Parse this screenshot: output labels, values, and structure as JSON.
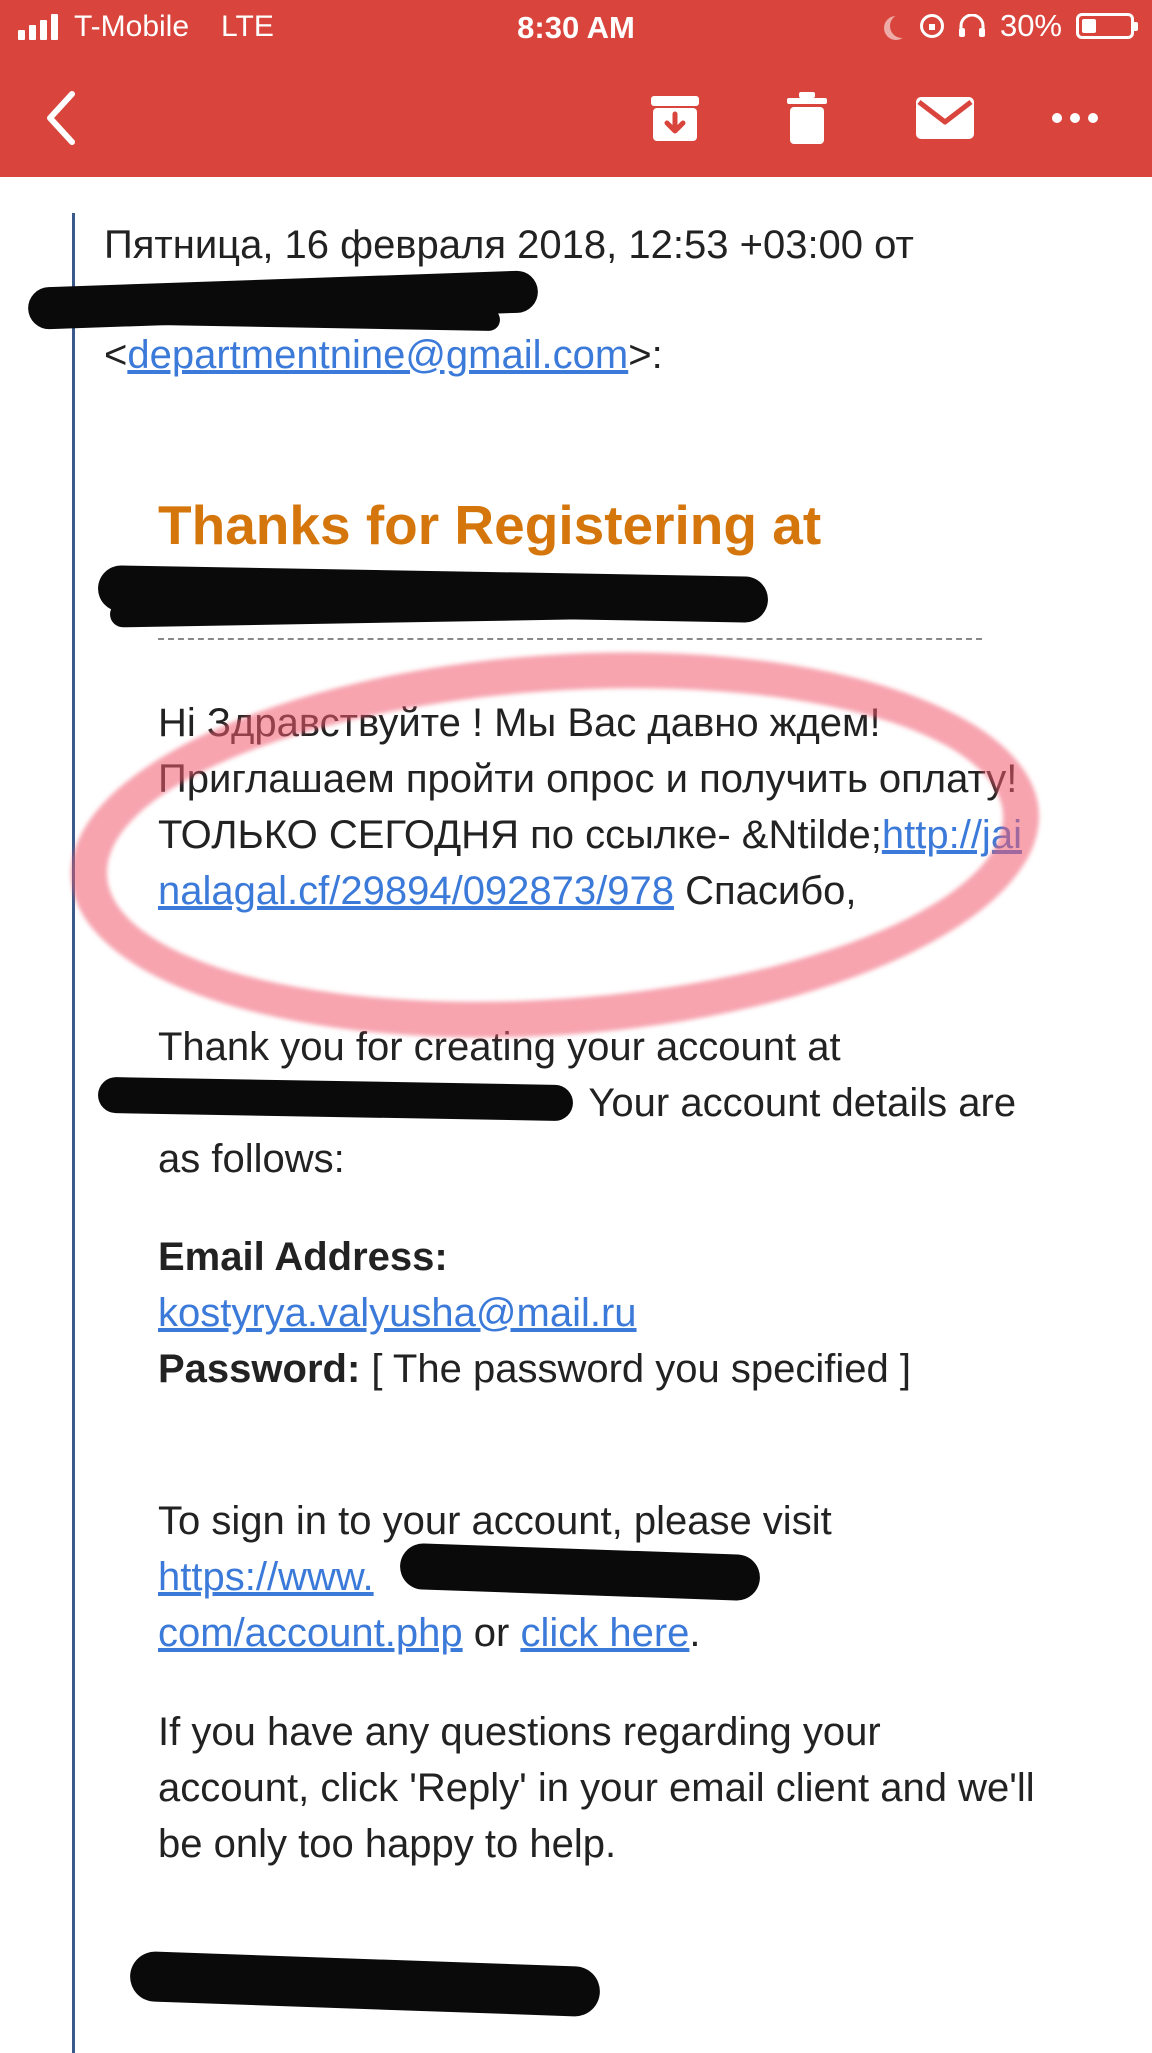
{
  "status_bar": {
    "carrier": "T-Mobile",
    "network": "LTE",
    "time": "8:30 AM",
    "battery": "30%",
    "battery_level": 0.3
  },
  "toolbar": {
    "back_icon": "chevron-left-icon",
    "archive_icon": "archive-icon",
    "trash_icon": "trash-icon",
    "mail_icon": "envelope-icon",
    "more_icon": "ellipsis-icon"
  },
  "colors": {
    "toolbar_bg": "#d9453c",
    "title": "#d4760b",
    "link": "#3b7ad9",
    "annotation_circle": "#f05a6e"
  },
  "email": {
    "header_date": "Пятница, 16 февраля 2018, 12:53 +03:00 от",
    "sender_open": "<",
    "sender_email": "departmentnine@gmail.com",
    "sender_close": ">:",
    "title": "Thanks for Registering at",
    "russian_text": "Hi Здравствуйте ! Мы Вас давно ждем! Приглашаем пройти опрос и получить оплату! ТОЛЬКО СЕГОДНЯ по ссылке- &Ntilde;",
    "russian_link": "http://jainalagal.cf/29894/092873/978",
    "russian_suffix": " Спасибо,",
    "thanks_text_1": "Thank you for creating your account at",
    "thanks_text_2": " Your account details are as follows:",
    "email_label": "Email Address:",
    "email_value": "kostyrya.valyusha@mail.ru",
    "password_label": "Password:",
    "password_value": " [ The password you specified ]",
    "signin_text": "To sign in to your account, please visit ",
    "signin_link": "https://www.",
    "signin_link_2": "com/account.php",
    "signin_or": " or ",
    "click_here": "click here",
    "period": ".",
    "questions_text": "If you have any questions regarding your account, click 'Reply' in your email client and we'll be only too happy to help."
  }
}
